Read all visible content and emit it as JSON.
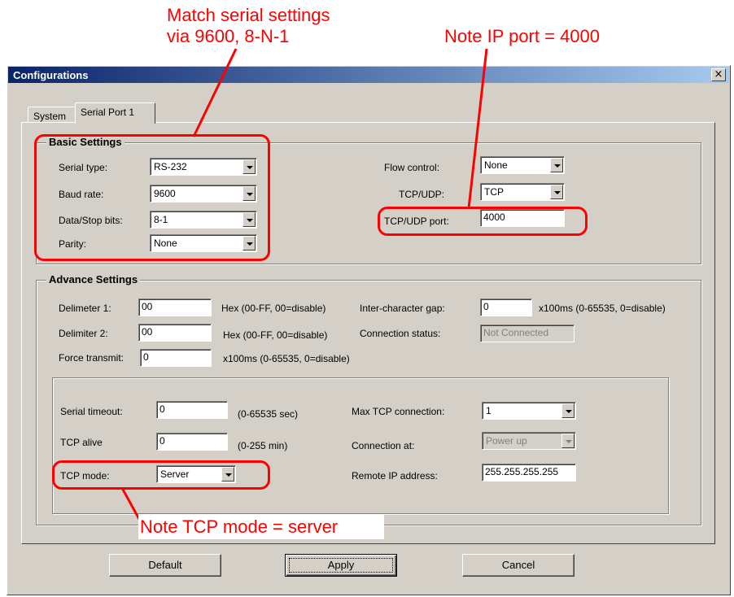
{
  "annotations": {
    "serial_line1": "Match serial settings",
    "serial_line2": "via 9600, 8-N-1",
    "ip_port_note": "Note IP port = 4000",
    "tcp_mode_note": "Note TCP mode = server"
  },
  "window": {
    "title": "Configurations",
    "close_glyph": "×"
  },
  "tabs": [
    {
      "label": "System"
    },
    {
      "label": "Serial Port 1"
    }
  ],
  "basic": {
    "title": "Basic Settings",
    "serial_type": {
      "label": "Serial type:",
      "value": "RS-232"
    },
    "baud_rate": {
      "label": "Baud rate:",
      "value": "9600"
    },
    "data_stop": {
      "label": "Data/Stop bits:",
      "value": "8-1"
    },
    "parity": {
      "label": "Parity:",
      "value": "None"
    },
    "flow_control": {
      "label": "Flow control:",
      "value": "None"
    },
    "tcp_udp": {
      "label": "TCP/UDP:",
      "value": "TCP"
    },
    "tcp_udp_port": {
      "label": "TCP/UDP port:",
      "value": "4000"
    }
  },
  "advance": {
    "title": "Advance Settings",
    "delim1": {
      "label": "Delimeter 1:",
      "value": "00",
      "hint": "Hex (00-FF, 00=disable)"
    },
    "delim2": {
      "label": "Delimiter 2:",
      "value": "00",
      "hint": "Hex (00-FF, 00=disable)"
    },
    "force_transmit": {
      "label": "Force transmit:",
      "value": "0",
      "hint": "x100ms (0-65535, 0=disable)"
    },
    "inter_char_gap": {
      "label": "Inter-character gap:",
      "value": "0",
      "hint": "x100ms (0-65535, 0=disable)"
    },
    "conn_status": {
      "label": "Connection status:",
      "value": "Not Connected"
    }
  },
  "tcp": {
    "serial_timeout": {
      "label": "Serial timeout:",
      "value": "0",
      "hint": "(0-65535 sec)"
    },
    "tcp_alive": {
      "label": "TCP alive",
      "value": "0",
      "hint": "(0-255 min)"
    },
    "tcp_mode": {
      "label": "TCP mode:",
      "value": "Server"
    },
    "max_tcp": {
      "label": "Max TCP connection:",
      "value": "1"
    },
    "connection_at": {
      "label": "Connection at:",
      "value": "Power up"
    },
    "remote_ip": {
      "label": "Remote IP address:",
      "value": "255.255.255.255"
    }
  },
  "buttons": {
    "default": "Default",
    "apply": "Apply",
    "cancel": "Cancel"
  },
  "colors": {
    "annotation": "#ff0000",
    "titlebar_start": "#0a246a",
    "titlebar_end": "#a6caf0",
    "dialog_face": "#d4d0c8"
  }
}
